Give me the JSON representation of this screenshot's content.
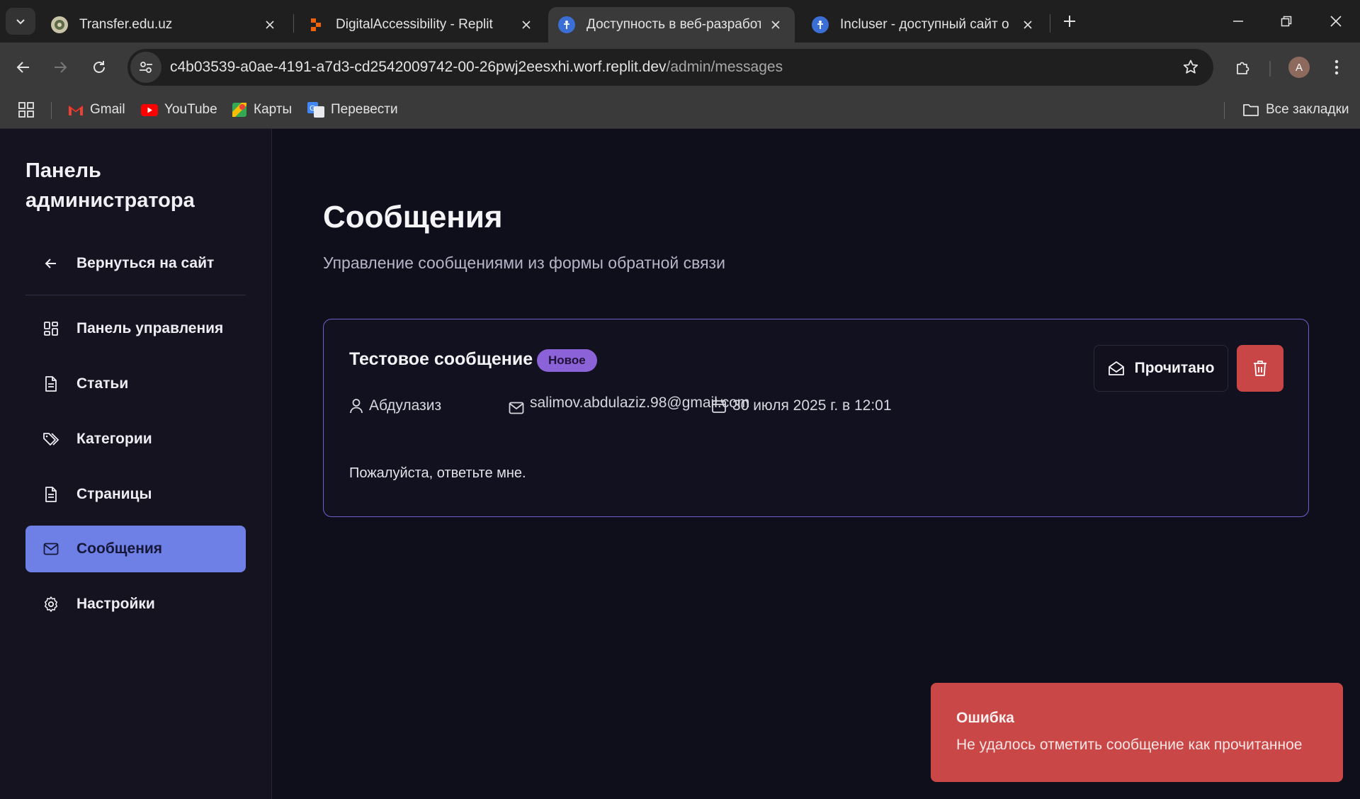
{
  "browser": {
    "tabs": [
      {
        "title": "Transfer.edu.uz"
      },
      {
        "title": "DigitalAccessibility - Replit"
      },
      {
        "title": "Доступность в веб-разработке"
      },
      {
        "title": "Incluser - доступный сайт о доступности"
      }
    ],
    "url": {
      "host": "c4b03539-a0ae-4191-a7d3-cd2542009742-00-26pwj2eesxhi.worf.replit.dev",
      "path": "/admin/messages"
    },
    "profile_initial": "A",
    "bookmarks": [
      {
        "label": "Gmail"
      },
      {
        "label": "YouTube"
      },
      {
        "label": "Карты"
      },
      {
        "label": "Перевести"
      }
    ],
    "all_bookmarks_label": "Все закладки"
  },
  "sidebar": {
    "title": "Панель администратора",
    "back_label": "Вернуться на сайт",
    "items": [
      {
        "label": "Панель управления"
      },
      {
        "label": "Статьи"
      },
      {
        "label": "Категории"
      },
      {
        "label": "Страницы"
      },
      {
        "label": "Сообщения"
      },
      {
        "label": "Настройки"
      }
    ],
    "active_item": "Сообщения",
    "accent_color": "#6e7fe6"
  },
  "main": {
    "title": "Сообщения",
    "subtitle": "Управление сообщениями из формы обратной связи"
  },
  "message": {
    "subject": "Тестовое сообщение",
    "badge": "Новое",
    "author": "Абдулазиз",
    "email": "salimov.abdulaziz.98@gmail.com",
    "date": "30 июля 2025 г. в 12:01",
    "body": "Пожалуйста, ответьте мне.",
    "mark_read_label": "Прочитано"
  },
  "toast": {
    "title": "Ошибка",
    "description": "Не удалось отметить сообщение как прочитанное",
    "color": "#c94747"
  }
}
